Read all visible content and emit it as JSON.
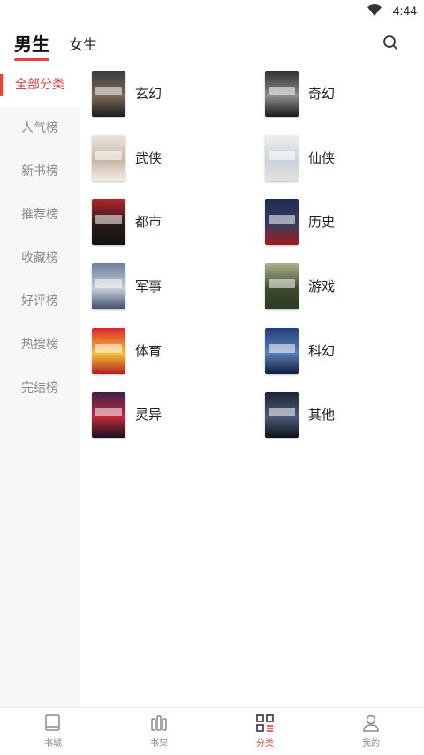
{
  "status_bar": {
    "time": "4:44"
  },
  "header": {
    "tabs": [
      {
        "label": "男生",
        "active": true
      },
      {
        "label": "女生",
        "active": false
      }
    ]
  },
  "sidebar": {
    "items": [
      {
        "label": "全部分类",
        "active": true
      },
      {
        "label": "人气榜",
        "active": false
      },
      {
        "label": "新书榜",
        "active": false
      },
      {
        "label": "推荐榜",
        "active": false
      },
      {
        "label": "收藏榜",
        "active": false
      },
      {
        "label": "好评榜",
        "active": false
      },
      {
        "label": "热搜榜",
        "active": false
      },
      {
        "label": "完结榜",
        "active": false
      }
    ]
  },
  "categories": [
    {
      "label": "玄幻",
      "cover_colors": [
        "#3b3b3b",
        "#7a6a58",
        "#1d1d1d"
      ]
    },
    {
      "label": "奇幻",
      "cover_colors": [
        "#2f2f2f",
        "#8c8c8c",
        "#1a1a1a"
      ]
    },
    {
      "label": "武侠",
      "cover_colors": [
        "#e9e4dc",
        "#c7b9a6",
        "#f3efe8"
      ]
    },
    {
      "label": "仙侠",
      "cover_colors": [
        "#f1eee9",
        "#c9d4de",
        "#e6e1d9"
      ]
    },
    {
      "label": "都市",
      "cover_colors": [
        "#b3262a",
        "#2b1a1a",
        "#121212"
      ]
    },
    {
      "label": "历史",
      "cover_colors": [
        "#1d2b54",
        "#3a3a5e",
        "#9c1e1e"
      ]
    },
    {
      "label": "军事",
      "cover_colors": [
        "#6b7f9e",
        "#c7ced8",
        "#3c4d69"
      ]
    },
    {
      "label": "游戏",
      "cover_colors": [
        "#a9b38a",
        "#3f4a2c",
        "#2a3a22"
      ]
    },
    {
      "label": "体育",
      "cover_colors": [
        "#d9262a",
        "#f2c43a",
        "#b31f1f"
      ]
    },
    {
      "label": "科幻",
      "cover_colors": [
        "#1f3f7a",
        "#5b7fb8",
        "#0f1e3d"
      ]
    },
    {
      "label": "灵异",
      "cover_colors": [
        "#3b1f4a",
        "#c02a3a",
        "#1a1020"
      ]
    },
    {
      "label": "其他",
      "cover_colors": [
        "#1c2433",
        "#4a5a78",
        "#0e131c"
      ]
    }
  ],
  "bottom_nav": [
    {
      "label": "书城",
      "icon": "book-icon",
      "active": false
    },
    {
      "label": "书架",
      "icon": "bookshelf-icon",
      "active": false
    },
    {
      "label": "分类",
      "icon": "category-grid-icon",
      "active": true
    },
    {
      "label": "我的",
      "icon": "user-icon",
      "active": false
    }
  ],
  "colors": {
    "accent": "#e8433a",
    "sidebar_bg": "#f7f7f7",
    "muted_text": "#8a8a8a"
  }
}
